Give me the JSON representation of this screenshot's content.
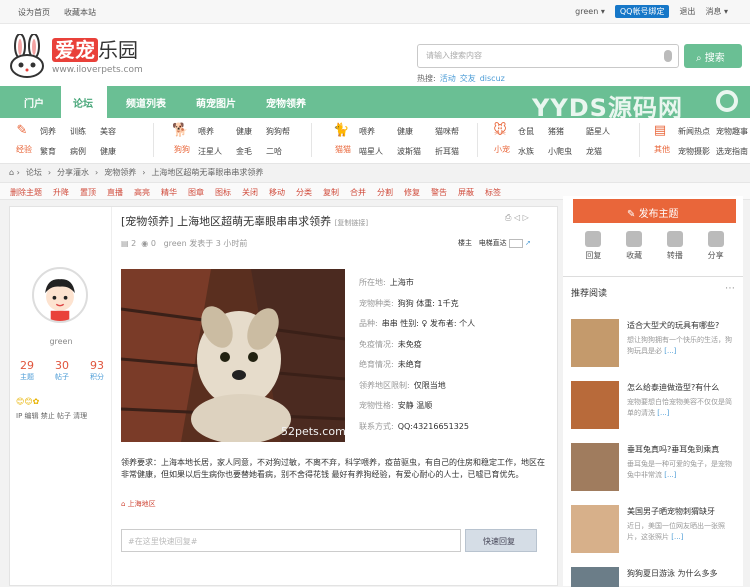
{
  "topbar": {
    "set_home": "设为首页",
    "bookmark": "收藏本站",
    "user": "green ▾",
    "qq": "QQ帐号绑定",
    "logout": "退出",
    "messages": "消息 ▾"
  },
  "logo": {
    "brand_red": "爱宠",
    "brand_black": "乐园",
    "url": "www.iloverpets.com"
  },
  "search": {
    "placeholder": "请输入搜索内容",
    "button": "搜索",
    "hot_label": "热搜:",
    "hot": [
      "活动",
      "交友",
      "discuz"
    ]
  },
  "nav": {
    "items": [
      "门户",
      "论坛",
      "频道列表",
      "萌宠图片",
      "宠物领养"
    ],
    "active": "论坛",
    "watermark": "YYDS源码网"
  },
  "subnav": [
    {
      "label": "经验",
      "links": [
        "饲养",
        "训练",
        "美容",
        "繁育",
        "病例",
        "健康"
      ]
    },
    {
      "label": "狗狗",
      "links": [
        "喂养",
        "健康",
        "狗狗帮",
        "汪星人",
        "金毛",
        "二哈"
      ]
    },
    {
      "label": "猫猫",
      "links": [
        "喂养",
        "健康",
        "猫咪帮",
        "喵星人",
        "波斯猫",
        "折耳猫"
      ]
    },
    {
      "label": "小宠",
      "links": [
        "仓鼠",
        "猪猪",
        "鼯星人",
        "水族",
        "小爬虫",
        "龙猫"
      ]
    },
    {
      "label": "其他",
      "links": [
        "新闻热点",
        "宠物趣事",
        "宠物摄影",
        "选宠指南"
      ]
    }
  ],
  "breadcrumb": [
    "论坛",
    "分享灌水",
    "宠物领养",
    "上海地区超萌无辜眼串串求领养"
  ],
  "tools": [
    "删除主题",
    "升降",
    "置顶",
    "直播",
    "高亮",
    "精华",
    "图章",
    "图标",
    "关闭",
    "移动",
    "分类",
    "复制",
    "合并",
    "分割",
    "修复",
    "警告",
    "屏蔽",
    "标签"
  ],
  "author": {
    "name": "green",
    "stats": [
      {
        "n": "29",
        "l": "主题"
      },
      {
        "n": "30",
        "l": "帖子"
      },
      {
        "n": "93",
        "l": "积分"
      }
    ],
    "medals": "😊😊✿",
    "ops": "IP 编辑 禁止 帖子 清理"
  },
  "post": {
    "title": "[宠物领养] 上海地区超萌无辜眼串串求领养",
    "copy": "[复制链接]",
    "replies": "2",
    "views": "0",
    "meta": "green 发表于 3 小时前",
    "floor": "楼主",
    "elevator": "电梯直达",
    "info": [
      {
        "k": "所在地:",
        "v": "上海市"
      },
      {
        "k": "宠物种类:",
        "v": "狗狗 体重: 1千克"
      },
      {
        "k": "品种:",
        "v": "串串 性别: ♀ 发布者: 个人"
      },
      {
        "k": "免疫情况:",
        "v": "未免疫"
      },
      {
        "k": "绝育情况:",
        "v": "未绝育"
      },
      {
        "k": "领养地区限制:",
        "v": "仅限当地"
      },
      {
        "k": "宠物性格:",
        "v": "安静 温顺"
      },
      {
        "k": "联系方式:",
        "v": "QQ:43216651325"
      }
    ],
    "watermark": "52pets.com",
    "desc": "领养要求：上海本地长居，家人同意，不对狗过敏，不离不弃，科学喂养，疫苗驱虫，有自己的住房和稳定工作，地区在非常健康，但如果以后生病你也要替她看病，别不舍得花钱 最好有养狗经验，有爱心耐心的人士，已嘘已育优先。",
    "tag": "上海地区",
    "reply_placeholder": "#在这里快速回复#",
    "reply_button": "快速回复"
  },
  "sidebar": {
    "post_button": "发布主题",
    "actions": [
      "回复",
      "收藏",
      "转播",
      "分享"
    ],
    "title": "推荐阅读",
    "articles": [
      {
        "t": "适合大型犬的玩具有哪些?",
        "d": "想让狗狗拥有一个快乐的生活，狗狗玩具是必",
        "c": "#c49a6c"
      },
      {
        "t": "怎么给泰迪做造型?有什么",
        "d": "宠物要想白恰宠物美容不仅仅是简单的清洗",
        "c": "#b86a3a"
      },
      {
        "t": "垂耳兔真吗?垂耳兔到乘真",
        "d": "垂耳兔是一种可爱的兔子，是宠物兔中非常流",
        "c": "#a07c5e"
      },
      {
        "t": "美国男子晒宠物刺猬缺牙",
        "d": "近日，美国一位网友晒出一张照片，这张照片",
        "c": "#d7b08a"
      },
      {
        "t": "狗狗夏日游泳 为什么多多",
        "d": "",
        "c": "#6b7d88"
      }
    ],
    "more": "[...]"
  }
}
